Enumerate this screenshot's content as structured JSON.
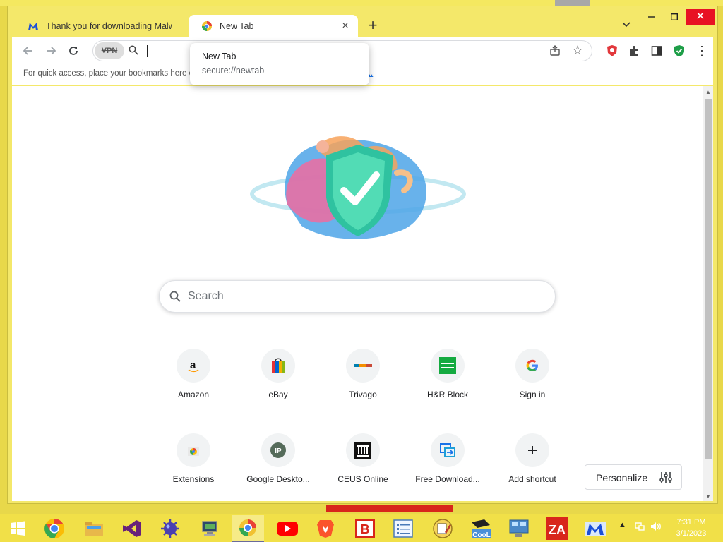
{
  "window": {
    "tabs": [
      {
        "title": "Thank you for downloading Malwa",
        "favicon": "malwarebytes-icon"
      },
      {
        "title": "New Tab",
        "favicon": "browser-logo-icon",
        "active": true
      }
    ],
    "controls": {
      "minimize": "🗕",
      "maximize": "🗖",
      "close": "✕"
    }
  },
  "toolbar": {
    "vpn_label": "VPN",
    "omnibox_value": ""
  },
  "bookmarks_bar": {
    "message": "For quick access, place your bookmarks here on the bookmarks bar.",
    "link_text": "w..."
  },
  "hover_card": {
    "title": "New Tab",
    "url": "secure://newtab"
  },
  "search": {
    "placeholder": "Search"
  },
  "shortcuts": [
    {
      "label": "Amazon",
      "icon": "amazon-icon"
    },
    {
      "label": "eBay",
      "icon": "ebay-bag-icon"
    },
    {
      "label": "Trivago",
      "icon": "trivago-icon"
    },
    {
      "label": "H&R Block",
      "icon": "hr-block-icon"
    },
    {
      "label": "Sign in",
      "icon": "google-g-icon"
    },
    {
      "label": "Extensions",
      "icon": "chrome-store-icon"
    },
    {
      "label": "Google Deskto...",
      "icon": "ip-icon"
    },
    {
      "label": "CEUS Online",
      "icon": "ceus-building-icon"
    },
    {
      "label": "Free Download...",
      "icon": "download-icon"
    },
    {
      "label": "Add shortcut",
      "icon": "plus-icon"
    }
  ],
  "personalize": {
    "label": "Personalize"
  },
  "taskbar": {
    "clock_time": "7:31 PM",
    "clock_date": "3/1/2023",
    "ie_letter": "B",
    "za_text": "ZA",
    "cool_text": "CooL"
  },
  "colors": {
    "desktop": "#e8d84a",
    "window_frame": "#f4e86a",
    "close_red": "#e81123",
    "link_blue": "#1a73e8"
  }
}
